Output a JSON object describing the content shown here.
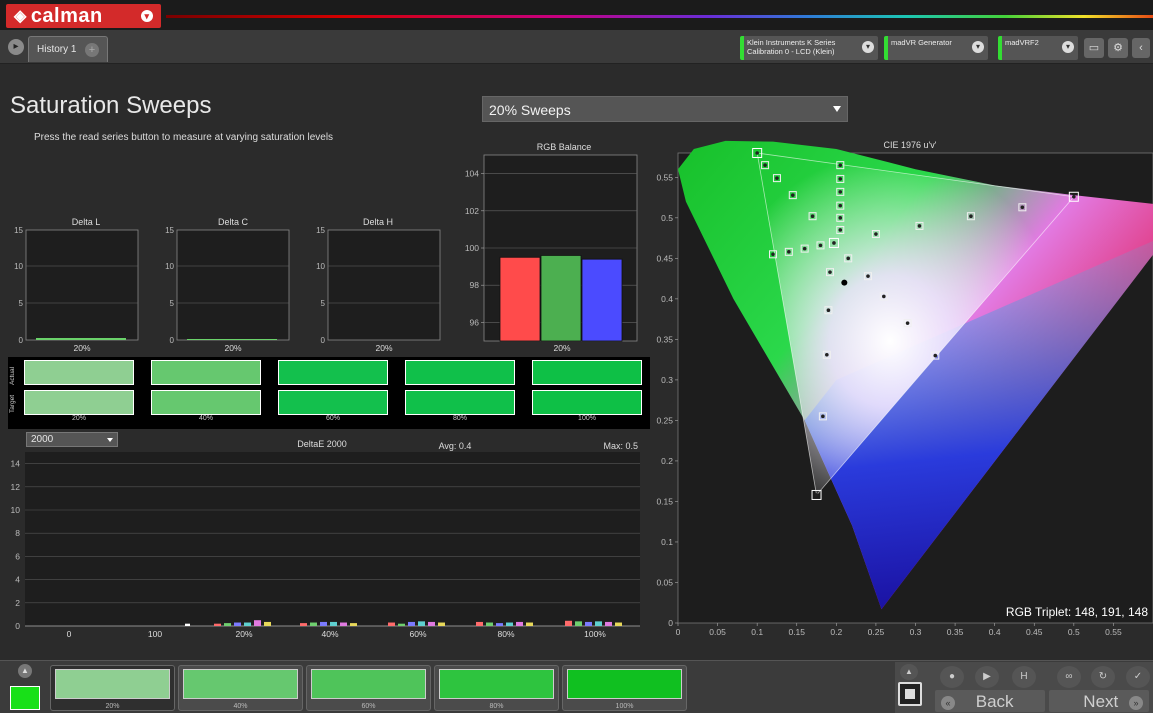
{
  "app": {
    "logo": "calman"
  },
  "tabs": [
    {
      "label": "History 1"
    }
  ],
  "devices": [
    {
      "line1": "Klein Instruments K Series",
      "line2": "Calibration 0 - LCD (Klein)"
    },
    {
      "line1": "madVR Generator",
      "line2": ""
    },
    {
      "line1": "madVRF2",
      "line2": ""
    }
  ],
  "page": {
    "title": "Saturation Sweeps",
    "subtitle": "Press the read series button to measure at varying saturation levels",
    "sweep_select": "20% Sweeps"
  },
  "delta_charts": [
    {
      "title": "Delta L",
      "yticks": [
        "15",
        "10",
        "5",
        "0"
      ],
      "xlabel": "20%"
    },
    {
      "title": "Delta C",
      "yticks": [
        "15",
        "10",
        "5",
        "0"
      ],
      "xlabel": "20%"
    },
    {
      "title": "Delta H",
      "yticks": [
        "15",
        "10",
        "5",
        "0"
      ],
      "xlabel": "20%"
    }
  ],
  "rgb_balance": {
    "title": "RGB Balance",
    "yticks": [
      "104",
      "102",
      "100",
      "98",
      "96"
    ],
    "xlabel": "20%"
  },
  "swatch_strip": {
    "row_labels": {
      "actual": "Actual",
      "target": "Target"
    },
    "levels": [
      "20%",
      "40%",
      "60%",
      "80%",
      "100%"
    ],
    "colors": [
      "#8fcf92",
      "#66c86f",
      "#13c04d",
      "#10c04a",
      "#0ec046"
    ]
  },
  "deltae": {
    "select_value": "2000",
    "title": "DeltaE 2000",
    "avg": "Avg: 0.4",
    "max": "Max: 0.5",
    "yticks": [
      "14",
      "12",
      "10",
      "8",
      "6",
      "4",
      "2",
      "0"
    ],
    "xlabels": [
      "0",
      "100",
      "20%",
      "40%",
      "60%",
      "80%",
      "100%"
    ]
  },
  "cie": {
    "title": "CIE 1976 u'v'",
    "xticks": [
      "0",
      "0.05",
      "0.1",
      "0.15",
      "0.2",
      "0.25",
      "0.3",
      "0.35",
      "0.4",
      "0.45",
      "0.5",
      "0.55"
    ],
    "yticks": [
      "0.55",
      "0.5",
      "0.45",
      "0.4",
      "0.35",
      "0.3",
      "0.25",
      "0.2",
      "0.15",
      "0.1",
      "0.05",
      "0"
    ],
    "rgb_triplet": "RGB Triplet: 148, 191, 148"
  },
  "bottom": {
    "tiles": [
      "20%",
      "40%",
      "60%",
      "80%",
      "100%"
    ],
    "tile_colors": [
      "#8fcf92",
      "#66c86f",
      "#4fc45a",
      "#2ec43f",
      "#10c020"
    ],
    "back": "Back",
    "next": "Next"
  },
  "chart_data": [
    {
      "type": "bar",
      "title": "RGB Balance",
      "categories": [
        "20%"
      ],
      "series": [
        {
          "name": "R",
          "values": [
            99.5
          ]
        },
        {
          "name": "G",
          "values": [
            99.6
          ]
        },
        {
          "name": "B",
          "values": [
            99.4
          ]
        }
      ],
      "ylim": [
        95,
        105
      ],
      "colors": [
        "#ff4b4b",
        "#4caf50",
        "#4b4bff"
      ]
    },
    {
      "type": "scatter",
      "title": "CIE 1976 u'v'",
      "xlim": [
        0,
        0.6
      ],
      "ylim": [
        0,
        0.58
      ],
      "targets": [
        {
          "u": 0.1,
          "v": 0.58
        },
        {
          "u": 0.11,
          "v": 0.565
        },
        {
          "u": 0.125,
          "v": 0.549
        },
        {
          "u": 0.145,
          "v": 0.528
        },
        {
          "u": 0.17,
          "v": 0.502
        },
        {
          "u": 0.197,
          "v": 0.469
        },
        {
          "u": 0.25,
          "v": 0.48
        },
        {
          "u": 0.305,
          "v": 0.49
        },
        {
          "u": 0.37,
          "v": 0.502
        },
        {
          "u": 0.435,
          "v": 0.513
        },
        {
          "u": 0.5,
          "v": 0.526
        },
        {
          "u": 0.24,
          "v": 0.428
        },
        {
          "u": 0.26,
          "v": 0.403
        },
        {
          "u": 0.29,
          "v": 0.37
        },
        {
          "u": 0.325,
          "v": 0.33
        },
        {
          "u": 0.192,
          "v": 0.433
        },
        {
          "u": 0.19,
          "v": 0.386
        },
        {
          "u": 0.188,
          "v": 0.331
        },
        {
          "u": 0.183,
          "v": 0.255
        },
        {
          "u": 0.175,
          "v": 0.158
        },
        {
          "u": 0.12,
          "v": 0.455
        },
        {
          "u": 0.14,
          "v": 0.458
        },
        {
          "u": 0.16,
          "v": 0.462
        },
        {
          "u": 0.18,
          "v": 0.466
        },
        {
          "u": 0.205,
          "v": 0.565
        },
        {
          "u": 0.205,
          "v": 0.548
        },
        {
          "u": 0.205,
          "v": 0.532
        },
        {
          "u": 0.205,
          "v": 0.515
        },
        {
          "u": 0.205,
          "v": 0.5
        },
        {
          "u": 0.205,
          "v": 0.485
        },
        {
          "u": 0.215,
          "v": 0.45
        }
      ],
      "white_point": {
        "u": 0.2,
        "v": 0.425
      }
    }
  ]
}
